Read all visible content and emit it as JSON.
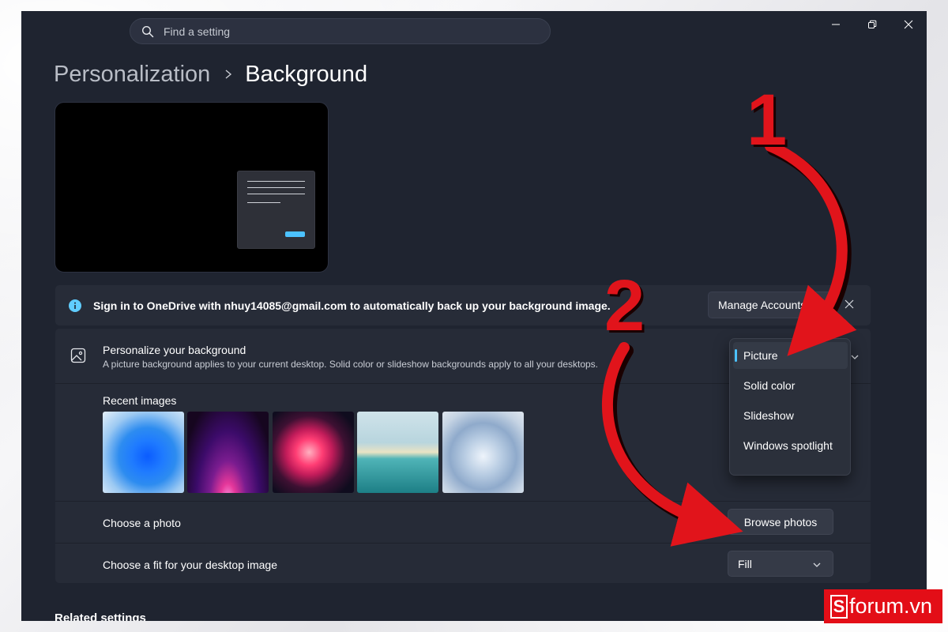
{
  "search": {
    "placeholder": "Find a setting"
  },
  "window_controls": [
    "minimize-icon",
    "restore-icon",
    "close-icon"
  ],
  "breadcrumb": {
    "parent": "Personalization",
    "current": "Background"
  },
  "info_bar": {
    "message": "Sign in to OneDrive with nhuy14085@gmail.com to automatically back up your background image.",
    "button_label": "Manage Accounts"
  },
  "personalize": {
    "title": "Personalize your background",
    "subtitle": "A picture background applies to your current desktop. Solid color or slideshow backgrounds apply to all your desktops."
  },
  "recent_images": {
    "label": "Recent images",
    "count": 5
  },
  "choose_photo": {
    "label": "Choose a photo",
    "button_label": "Browse photos"
  },
  "fit": {
    "label": "Choose a fit for your desktop image",
    "value": "Fill"
  },
  "background_menu": {
    "items": [
      "Picture",
      "Solid color",
      "Slideshow",
      "Windows spotlight"
    ],
    "selected": "Picture"
  },
  "related": {
    "label": "Related settings"
  },
  "annotations": {
    "step1": "1",
    "step2": "2",
    "color": "#e1141b"
  },
  "watermark": {
    "text": "forum.vn",
    "icon_letter": "S"
  },
  "colors": {
    "accent": "#4cc2ff",
    "window_bg": "#1f2430",
    "card_bg": "#262b37"
  }
}
